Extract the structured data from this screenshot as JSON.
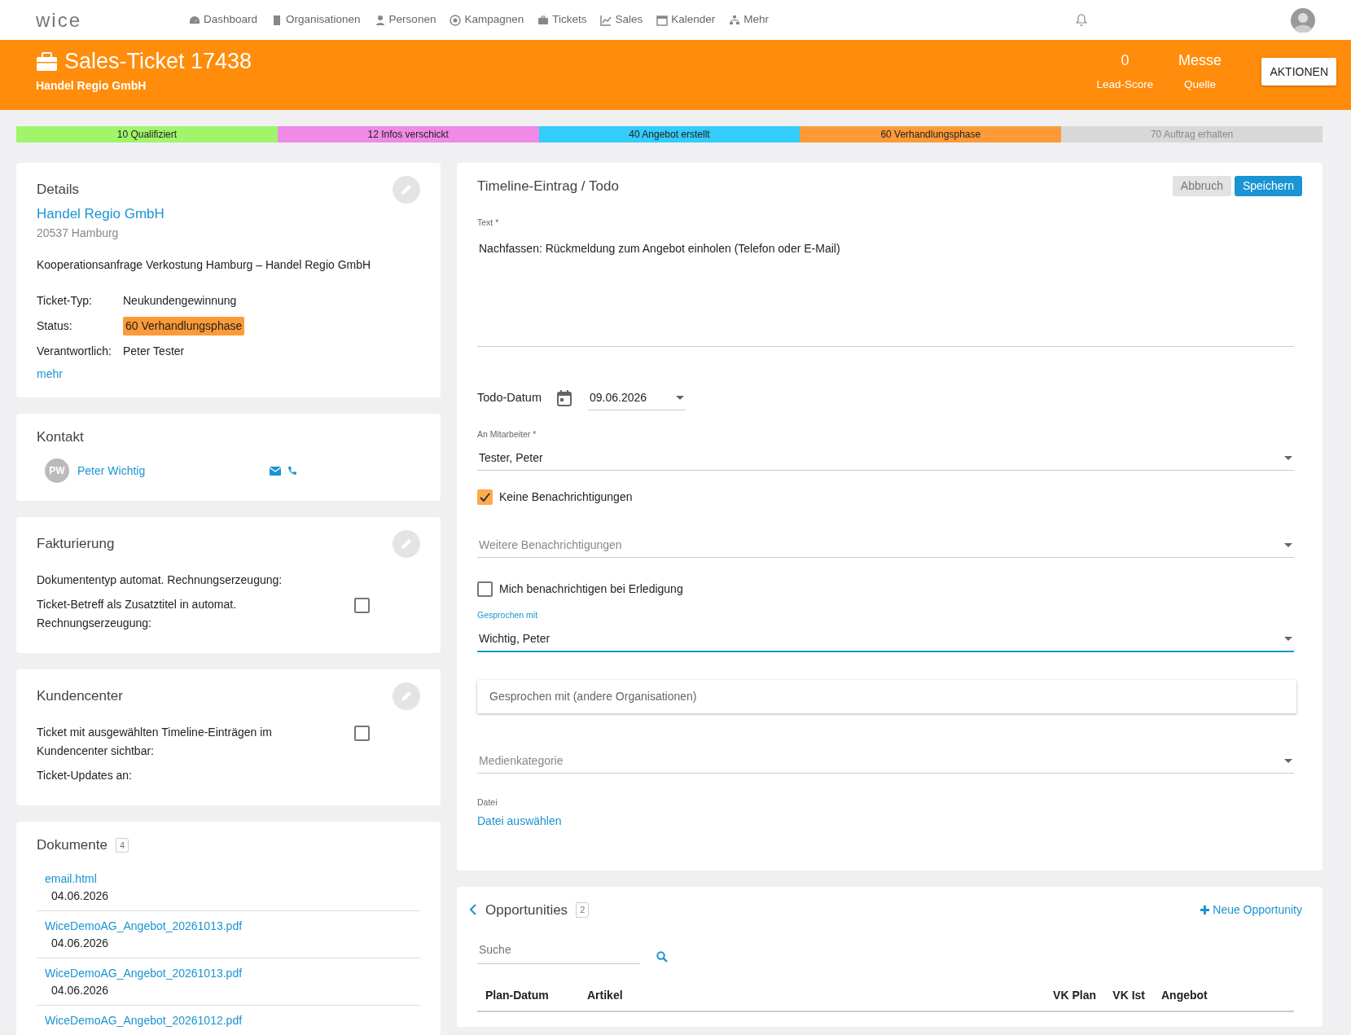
{
  "brand": "wice",
  "nav": [
    {
      "label": "Dashboard"
    },
    {
      "label": "Organisationen"
    },
    {
      "label": "Personen"
    },
    {
      "label": "Kampagnen"
    },
    {
      "label": "Tickets"
    },
    {
      "label": "Sales"
    },
    {
      "label": "Kalender"
    },
    {
      "label": "Mehr"
    }
  ],
  "header": {
    "title": "Sales-Ticket 17438",
    "subtitle": "Handel Regio GmbH",
    "stats": [
      {
        "value": "0",
        "label": "Lead-Score"
      },
      {
        "value": "Messe",
        "label": "Quelle"
      }
    ],
    "action": "AKTIONEN"
  },
  "stages": [
    {
      "label": "10 Qualifiziert",
      "color": "#a0f56a",
      "reached": true
    },
    {
      "label": "12 Infos verschickt",
      "color": "#f08ae6",
      "reached": true
    },
    {
      "label": "40 Angebot erstellt",
      "color": "#33ccfb",
      "reached": true
    },
    {
      "label": "60 Verhandlungsphase",
      "color": "#fd9a38",
      "reached": true
    },
    {
      "label": "70 Auftrag erhalten",
      "color": "#d8d8d8",
      "reached": false
    }
  ],
  "details": {
    "title": "Details",
    "company": "Handel Regio GmbH",
    "city": "20537 Hamburg",
    "subject": "Kooperationsanfrage Verkostung Hamburg – Handel Regio GmbH",
    "fields": [
      {
        "label": "Ticket-Typ:",
        "value": "Neukundengewinnung",
        "kind": "text"
      },
      {
        "label": "Status:",
        "value": "60 Verhandlungsphase",
        "kind": "status",
        "color": "#fd9a38"
      },
      {
        "label": "Verantwortlich:",
        "value": "Peter Tester",
        "kind": "text"
      }
    ],
    "more": "mehr"
  },
  "contact": {
    "title": "Kontakt",
    "initials": "PW",
    "name": "Peter Wichtig"
  },
  "billing": {
    "title": "Fakturierung",
    "rows": [
      {
        "label": "Dokumententyp automat. Rechnungserzeugung:",
        "kind": "text"
      },
      {
        "label": "Ticket-Betreff als Zusatztitel in automat. Rechnungserzeugung:",
        "kind": "checkbox",
        "checked": false
      }
    ]
  },
  "customer_center": {
    "title": "Kundencenter",
    "rows": [
      {
        "label": "Ticket mit ausgewählten Timeline-Einträgen im Kundencenter sichtbar:",
        "kind": "checkbox",
        "checked": false
      },
      {
        "label": "Ticket-Updates an:",
        "kind": "text"
      }
    ]
  },
  "documents": {
    "title": "Dokumente",
    "count": "4",
    "items": [
      {
        "name": "email.html",
        "date": "04.06.2026"
      },
      {
        "name": "WiceDemoAG_Angebot_20261013.pdf",
        "date": "04.06.2026"
      },
      {
        "name": "WiceDemoAG_Angebot_20261013.pdf",
        "date": "04.06.2026"
      },
      {
        "name": "WiceDemoAG_Angebot_20261012.pdf"
      }
    ]
  },
  "timeline_form": {
    "title": "Timeline-Eintrag / Todo",
    "cancel": "Abbruch",
    "save": "Speichern",
    "text_label": "Text *",
    "text_value": "Nachfassen: Rückmeldung zum Angebot einholen (Telefon oder E-Mail)",
    "todo_label": "Todo-Datum",
    "todo_date": "09.06.2026",
    "employee": {
      "label": "An Mitarbeiter *",
      "value": "Tester, Peter"
    },
    "no_notify": {
      "label": "Keine Benachrichtigungen",
      "checked": true
    },
    "more_notify": {
      "placeholder": "Weitere Benachrichtigungen"
    },
    "notify_done": {
      "label": "Mich benachrichtigen bei Erledigung",
      "checked": false
    },
    "spoken_with": {
      "label": "Gesprochen mit",
      "value": "Wichtig, Peter",
      "focused": true
    },
    "spoken_other": {
      "placeholder": "Gesprochen mit (andere Organisationen)"
    },
    "media": {
      "placeholder": "Medienkategorie"
    },
    "file_label": "Datei",
    "file_link": "Datei auswählen"
  },
  "opportunities": {
    "title": "Opportunities",
    "count": "2",
    "new": "Neue Opportunity",
    "search_placeholder": "Suche",
    "columns": [
      "Plan-Datum",
      "Artikel",
      "VK Plan",
      "VK Ist",
      "Angebot"
    ]
  }
}
